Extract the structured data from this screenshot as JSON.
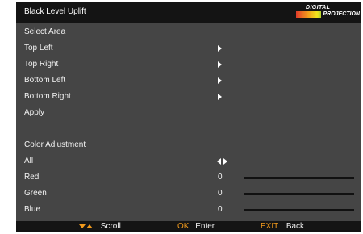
{
  "header": {
    "title": "Black Level Uplift",
    "logo": {
      "line1": "DIGITAL",
      "line2": "PROJECTION"
    }
  },
  "menu": {
    "select_area": {
      "label": "Select Area"
    },
    "areas": [
      {
        "label": "Top Left",
        "icon": "arrow-right-icon"
      },
      {
        "label": "Top Right",
        "icon": "arrow-right-icon"
      },
      {
        "label": "Bottom Left",
        "icon": "arrow-right-icon"
      },
      {
        "label": "Bottom Right",
        "icon": "arrow-right-icon"
      }
    ],
    "apply": {
      "label": "Apply"
    },
    "color_adjustment": {
      "label": "Color Adjustment"
    },
    "all": {
      "label": "All",
      "icon": "left-right-arrows-icon"
    },
    "channels": [
      {
        "label": "Red",
        "value": "0",
        "level": 0
      },
      {
        "label": "Green",
        "value": "0",
        "level": 0
      },
      {
        "label": "Blue",
        "value": "0",
        "level": 0
      }
    ]
  },
  "footer": {
    "scroll": {
      "icon": "up-down-arrows-icon",
      "label": "Scroll"
    },
    "enter": {
      "key": "OK",
      "label": "Enter"
    },
    "back": {
      "key": "EXIT",
      "label": "Back"
    }
  },
  "colors": {
    "panel": "#454545",
    "bar": "#141414",
    "accent": "#f29a1c",
    "text": "#f0f0f0"
  }
}
